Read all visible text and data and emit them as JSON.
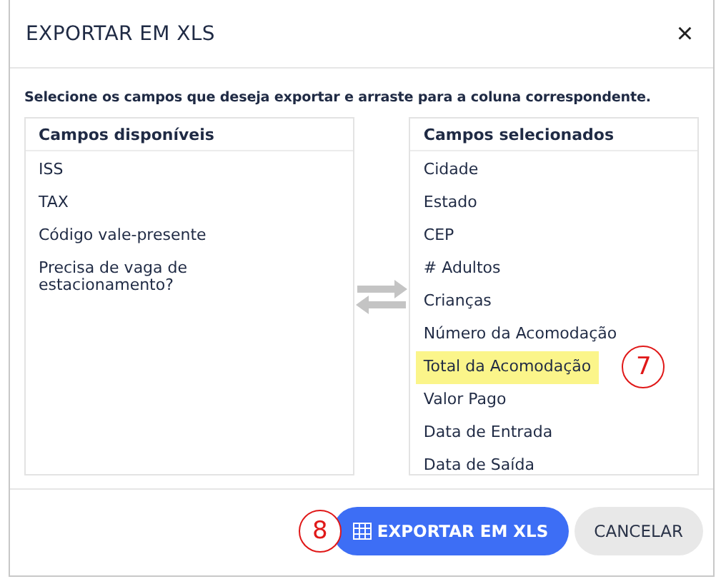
{
  "dialog": {
    "title": "EXPORTAR EM XLS",
    "close": "×"
  },
  "instruction": "Selecione os campos que deseja exportar e arraste para a coluna correspondente.",
  "available": {
    "title": "Campos disponíveis",
    "items": [
      {
        "label": "ISS",
        "highlighted": false
      },
      {
        "label": "TAX",
        "highlighted": false
      },
      {
        "label": "Código vale-presente",
        "highlighted": false
      },
      {
        "label": "Precisa de vaga de estacionamento?",
        "highlighted": false
      }
    ]
  },
  "selected_fields": {
    "title": "Campos selecionados",
    "items": [
      {
        "label": "Cidade",
        "highlighted": false
      },
      {
        "label": "Estado",
        "highlighted": false
      },
      {
        "label": "CEP",
        "highlighted": false
      },
      {
        "label": "# Adultos",
        "highlighted": false
      },
      {
        "label": "Crianças",
        "highlighted": false
      },
      {
        "label": "Número da Acomodação",
        "highlighted": false
      },
      {
        "label": "Total da Acomodação",
        "highlighted": true,
        "callout": "7"
      },
      {
        "label": "Valor Pago",
        "highlighted": false
      },
      {
        "label": "Data de Entrada",
        "highlighted": false
      },
      {
        "label": "Data de Saída",
        "highlighted": false
      }
    ]
  },
  "buttons": [
    {
      "label": "EXPORTAR EM XLS",
      "kind": "primary",
      "callout": "8"
    },
    {
      "label": "CANCELAR",
      "kind": "secondary"
    }
  ]
}
